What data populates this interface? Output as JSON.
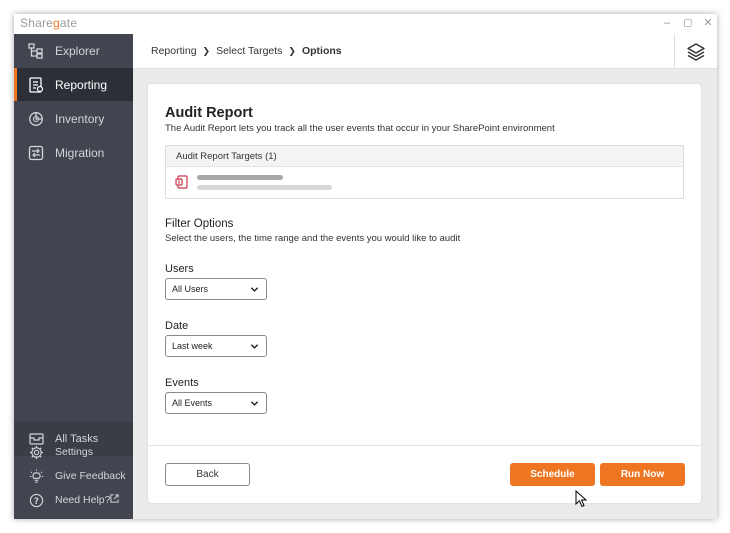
{
  "app": {
    "logo_text": "Sharegate",
    "accent_color": "#ee7623"
  },
  "window_controls": {
    "minimize": "–",
    "maximize": "◻",
    "close": "✕"
  },
  "sidebar": {
    "items": [
      {
        "label": "Explorer",
        "icon": "explorer-tree-icon"
      },
      {
        "label": "Reporting",
        "icon": "reporting-icon",
        "active": true
      },
      {
        "label": "Inventory",
        "icon": "inventory-icon"
      },
      {
        "label": "Migration",
        "icon": "migration-icon"
      }
    ],
    "all_tasks": "All Tasks",
    "settings": "Settings",
    "feedback": "Give Feedback",
    "help": "Need Help?"
  },
  "breadcrumb": [
    "Reporting",
    "Select Targets",
    "Options"
  ],
  "report": {
    "title": "Audit Report",
    "description": "The Audit Report lets you track all the user events that occur in your SharePoint environment",
    "targets_header": "Audit Report Targets (1)"
  },
  "filter": {
    "title": "Filter Options",
    "description": "Select the users, the time range and the events you would like to audit",
    "users_label": "Users",
    "users_value": "All Users",
    "date_label": "Date",
    "date_value": "Last week",
    "events_label": "Events",
    "events_value": "All Events"
  },
  "buttons": {
    "back": "Back",
    "schedule": "Schedule",
    "run_now": "Run Now"
  }
}
